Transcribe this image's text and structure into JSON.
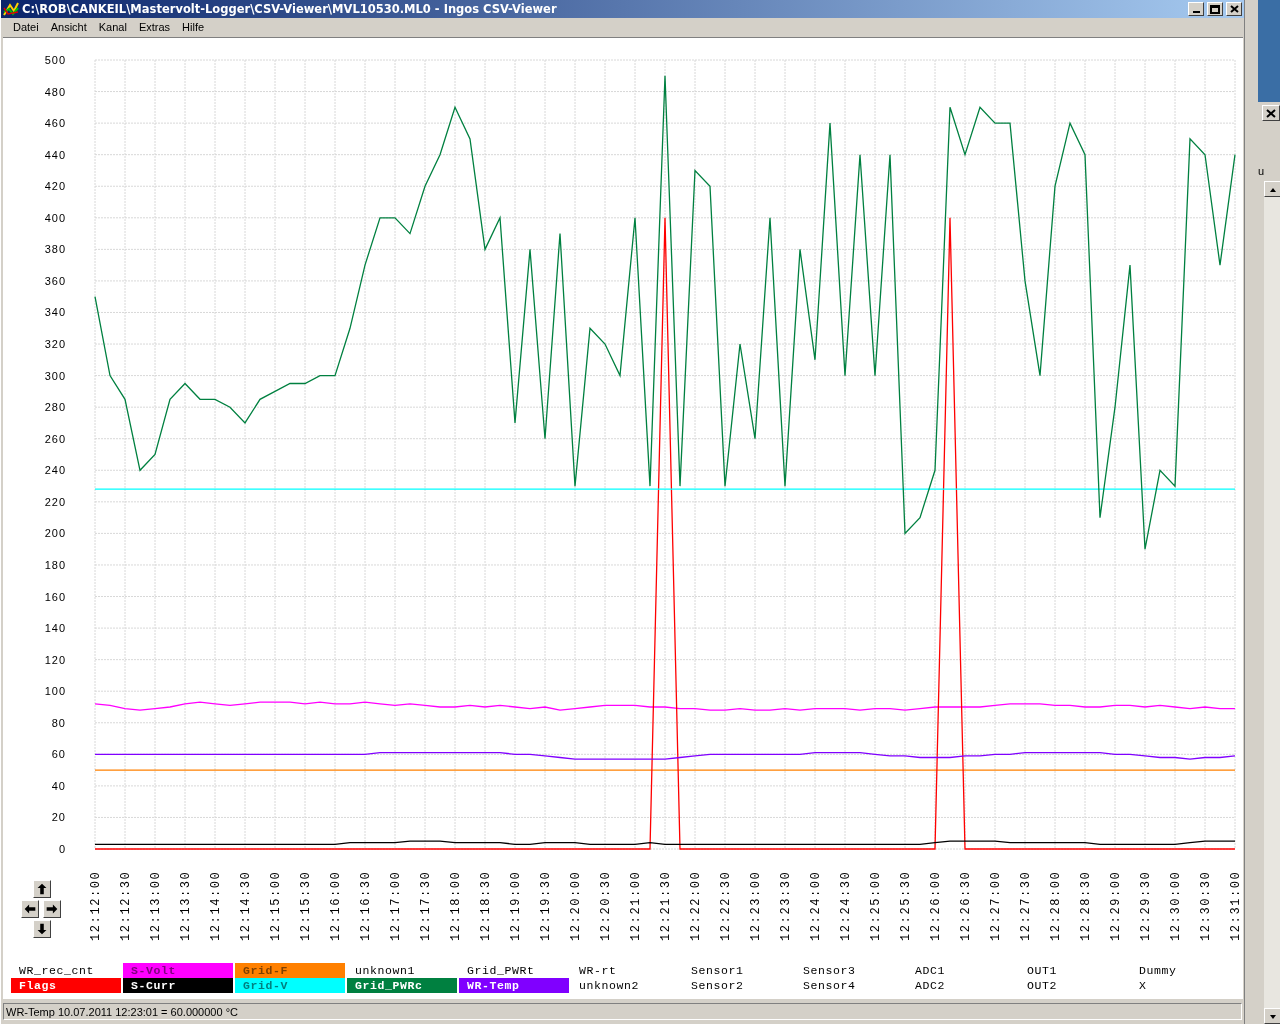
{
  "window": {
    "title": "C:\\ROB\\CANKEIL\\Mastervolt-Logger\\CSV-Viewer\\MVL10530.ML0 - Ingos CSV-Viewer"
  },
  "menu": [
    "Datei",
    "Ansicht",
    "Kanal",
    "Extras",
    "Hilfe"
  ],
  "chart_data": {
    "type": "line",
    "grid": true,
    "categories": [
      "12:12:00",
      null,
      "12:12:30",
      null,
      "12:13:00",
      null,
      "12:13:30",
      null,
      "12:14:00",
      null,
      "12:14:30",
      null,
      "12:15:00",
      null,
      "12:15:30",
      null,
      "12:16:00",
      null,
      "12:16:30",
      null,
      "12:17:00",
      null,
      "12:17:30",
      null,
      "12:18:00",
      null,
      "12:18:30",
      null,
      "12:19:00",
      null,
      "12:19:30",
      null,
      "12:20:00",
      null,
      "12:20:30",
      null,
      "12:21:00",
      null,
      "12:21:30",
      null,
      "12:22:00",
      null,
      "12:22:30",
      null,
      "12:23:00",
      null,
      "12:23:30",
      null,
      "12:24:00",
      null,
      "12:24:30",
      null,
      "12:25:00",
      null,
      "12:25:30",
      null,
      "12:26:00",
      null,
      "12:26:30",
      null,
      "12:27:00",
      null,
      "12:27:30",
      null,
      "12:28:00",
      null,
      "12:28:30",
      null,
      "12:29:00",
      null,
      "12:29:30",
      null,
      "12:30:00",
      null,
      "12:30:30",
      null,
      "12:31:00"
    ],
    "ylim": [
      0,
      500
    ],
    "yticks": [
      0,
      20,
      40,
      60,
      80,
      100,
      120,
      140,
      160,
      180,
      200,
      220,
      240,
      260,
      280,
      300,
      320,
      340,
      360,
      380,
      400,
      420,
      440,
      460,
      480,
      500
    ],
    "series": [
      {
        "name": "S-Volt",
        "color": "#ff00ff",
        "values": [
          92,
          91,
          89,
          88,
          89,
          90,
          92,
          93,
          92,
          91,
          92,
          93,
          93,
          93,
          92,
          93,
          92,
          92,
          93,
          92,
          91,
          92,
          91,
          90,
          90,
          91,
          90,
          91,
          90,
          89,
          90,
          88,
          89,
          90,
          91,
          91,
          91,
          90,
          90,
          89,
          89,
          88,
          88,
          89,
          88,
          88,
          89,
          88,
          89,
          89,
          89,
          88,
          89,
          89,
          88,
          89,
          90,
          90,
          90,
          90,
          91,
          92,
          92,
          92,
          91,
          91,
          90,
          90,
          91,
          91,
          90,
          91,
          90,
          89,
          90,
          89,
          89
        ]
      },
      {
        "name": "Grid-F",
        "color": "#ff8000",
        "values": [
          50,
          50,
          50,
          50,
          50,
          50,
          50,
          50,
          50,
          50,
          50,
          50,
          50,
          50,
          50,
          50,
          50,
          50,
          50,
          50,
          50,
          50,
          50,
          50,
          50,
          50,
          50,
          50,
          50,
          50,
          50,
          50,
          50,
          50,
          50,
          50,
          50,
          50,
          50,
          50,
          50,
          50,
          50,
          50,
          50,
          50,
          50,
          50,
          50,
          50,
          50,
          50,
          50,
          50,
          50,
          50,
          50,
          50,
          50,
          50,
          50,
          50,
          50,
          50,
          50,
          50,
          50,
          50,
          50,
          50,
          50,
          50,
          50,
          50,
          50,
          50,
          50
        ]
      },
      {
        "name": "Flags",
        "color": "#ff0000",
        "values": [
          0,
          0,
          0,
          0,
          0,
          0,
          0,
          0,
          0,
          0,
          0,
          0,
          0,
          0,
          0,
          0,
          0,
          0,
          0,
          0,
          0,
          0,
          0,
          0,
          0,
          0,
          0,
          0,
          0,
          0,
          0,
          0,
          0,
          0,
          0,
          0,
          0,
          0,
          400,
          0,
          0,
          0,
          0,
          0,
          0,
          0,
          0,
          0,
          0,
          0,
          0,
          0,
          0,
          0,
          0,
          0,
          0,
          400,
          0,
          0,
          0,
          0,
          0,
          0,
          0,
          0,
          0,
          0,
          0,
          0,
          0,
          0,
          0,
          0,
          0,
          0,
          0
        ]
      },
      {
        "name": "S-Curr",
        "color": "#000000",
        "values": [
          3,
          3,
          3,
          3,
          3,
          3,
          3,
          3,
          3,
          3,
          3,
          3,
          3,
          3,
          3,
          3,
          3,
          4,
          4,
          4,
          4,
          5,
          5,
          5,
          4,
          4,
          4,
          4,
          3,
          3,
          4,
          4,
          4,
          3,
          3,
          3,
          3,
          4,
          3,
          3,
          3,
          3,
          3,
          3,
          3,
          3,
          3,
          3,
          3,
          3,
          3,
          3,
          3,
          3,
          3,
          3,
          4,
          5,
          5,
          5,
          5,
          4,
          4,
          4,
          4,
          4,
          4,
          3,
          3,
          3,
          3,
          3,
          3,
          4,
          5,
          5,
          5
        ]
      },
      {
        "name": "Grid-V",
        "color": "#00ffff",
        "values": [
          228,
          228,
          228,
          228,
          228,
          228,
          228,
          228,
          228,
          228,
          228,
          228,
          228,
          228,
          228,
          228,
          228,
          228,
          228,
          228,
          228,
          228,
          228,
          228,
          228,
          228,
          228,
          228,
          228,
          228,
          228,
          228,
          228,
          228,
          228,
          228,
          228,
          228,
          228,
          228,
          228,
          228,
          228,
          228,
          228,
          228,
          228,
          228,
          228,
          228,
          228,
          228,
          228,
          228,
          228,
          228,
          228,
          228,
          228,
          228,
          228,
          228,
          228,
          228,
          228,
          228,
          228,
          228,
          228,
          228,
          228,
          228,
          228,
          228,
          228,
          228,
          228
        ]
      },
      {
        "name": "Grid_PWRc",
        "color": "#008040",
        "values": [
          350,
          300,
          285,
          240,
          250,
          285,
          295,
          285,
          285,
          280,
          270,
          285,
          290,
          295,
          295,
          300,
          300,
          330,
          370,
          400,
          400,
          390,
          420,
          440,
          470,
          450,
          380,
          400,
          270,
          380,
          260,
          390,
          230,
          330,
          320,
          300,
          400,
          230,
          490,
          230,
          430,
          420,
          230,
          320,
          260,
          400,
          230,
          380,
          310,
          460,
          300,
          440,
          300,
          440,
          200,
          210,
          240,
          470,
          440,
          470,
          460,
          460,
          360,
          300,
          420,
          460,
          440,
          210,
          280,
          370,
          190,
          240,
          230,
          450,
          440,
          370,
          440
        ]
      },
      {
        "name": "WR-Temp",
        "color": "#8000ff",
        "values": [
          60,
          60,
          60,
          60,
          60,
          60,
          60,
          60,
          60,
          60,
          60,
          60,
          60,
          60,
          60,
          60,
          60,
          60,
          60,
          61,
          61,
          61,
          61,
          61,
          61,
          61,
          61,
          61,
          60,
          60,
          59,
          58,
          57,
          57,
          57,
          57,
          57,
          57,
          57,
          58,
          59,
          60,
          60,
          60,
          60,
          60,
          60,
          60,
          61,
          61,
          61,
          61,
          60,
          59,
          59,
          58,
          58,
          58,
          59,
          59,
          60,
          60,
          61,
          61,
          61,
          61,
          61,
          61,
          60,
          60,
          59,
          58,
          58,
          57,
          58,
          58,
          59
        ]
      }
    ]
  },
  "legend": [
    [
      {
        "kind": "label",
        "label": "WR_rec_cnt"
      },
      {
        "kind": "series"
      },
      {
        "kind": "series"
      },
      {
        "kind": "label",
        "label": "unknown1"
      },
      {
        "kind": "label",
        "label": "Grid_PWRt"
      },
      {
        "kind": "label",
        "label": "WR-rt"
      },
      {
        "kind": "label",
        "label": "Sensor1"
      },
      {
        "kind": "label",
        "label": "Sensor3"
      },
      {
        "kind": "label",
        "label": "ADC1"
      },
      {
        "kind": "label",
        "label": "OUT1"
      },
      {
        "kind": "label",
        "label": "Dummy"
      }
    ],
    [
      {
        "kind": "series"
      },
      {
        "kind": "series"
      },
      {
        "kind": "series"
      },
      {
        "kind": "series"
      },
      {
        "kind": "series"
      },
      {
        "kind": "label",
        "label": "unknown2"
      },
      {
        "kind": "label",
        "label": "Sensor2"
      },
      {
        "kind": "label",
        "label": "Sensor4"
      },
      {
        "kind": "label",
        "label": "ADC2"
      },
      {
        "kind": "label",
        "label": "OUT2"
      },
      {
        "kind": "label",
        "label": "X"
      }
    ]
  ],
  "status_bar": "WR-Temp 10.07.2011 12:23:01 = 60.000000 °C",
  "background_window": {
    "text": "u"
  }
}
